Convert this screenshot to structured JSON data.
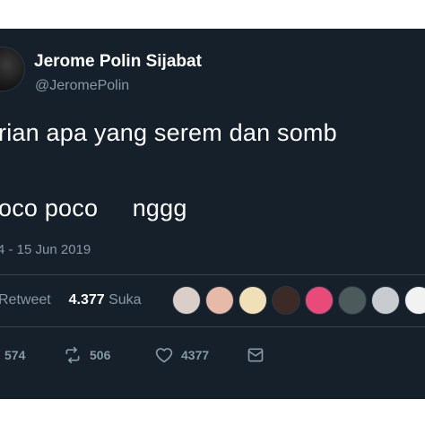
{
  "tweet": {
    "display_name": "Jerome Polin Sijabat",
    "handle": "@JeromePolin",
    "text_line1": "rian apa yang serem dan somb",
    "text_line2": "oco poco     nggg",
    "timestamp": "4 - 15 Jun 2019"
  },
  "stats": {
    "retweet_label": "Retweet",
    "like_count": "4.377",
    "like_label": "Suka"
  },
  "likers": [
    {
      "icon": "liker-avatar-1",
      "color": "#d9cfc8"
    },
    {
      "icon": "liker-avatar-2",
      "color": "#e7b9a8"
    },
    {
      "icon": "liker-avatar-3",
      "color": "#f0e0b8"
    },
    {
      "icon": "liker-avatar-4",
      "color": "#3b2a26"
    },
    {
      "icon": "liker-avatar-5",
      "color": "#e84a7a"
    },
    {
      "icon": "liker-avatar-6",
      "color": "#4d5a5c"
    },
    {
      "icon": "liker-avatar-7",
      "color": "#c8ccd0"
    },
    {
      "icon": "liker-avatar-8",
      "color": "#f2f2f2"
    }
  ],
  "actions": {
    "reply_count": "574",
    "retweet_count": "506",
    "like_count": "4377"
  },
  "colors": {
    "background": "#15202b",
    "text": "#ffffff",
    "secondary_text": "#8899a6",
    "divider": "#38444d"
  }
}
